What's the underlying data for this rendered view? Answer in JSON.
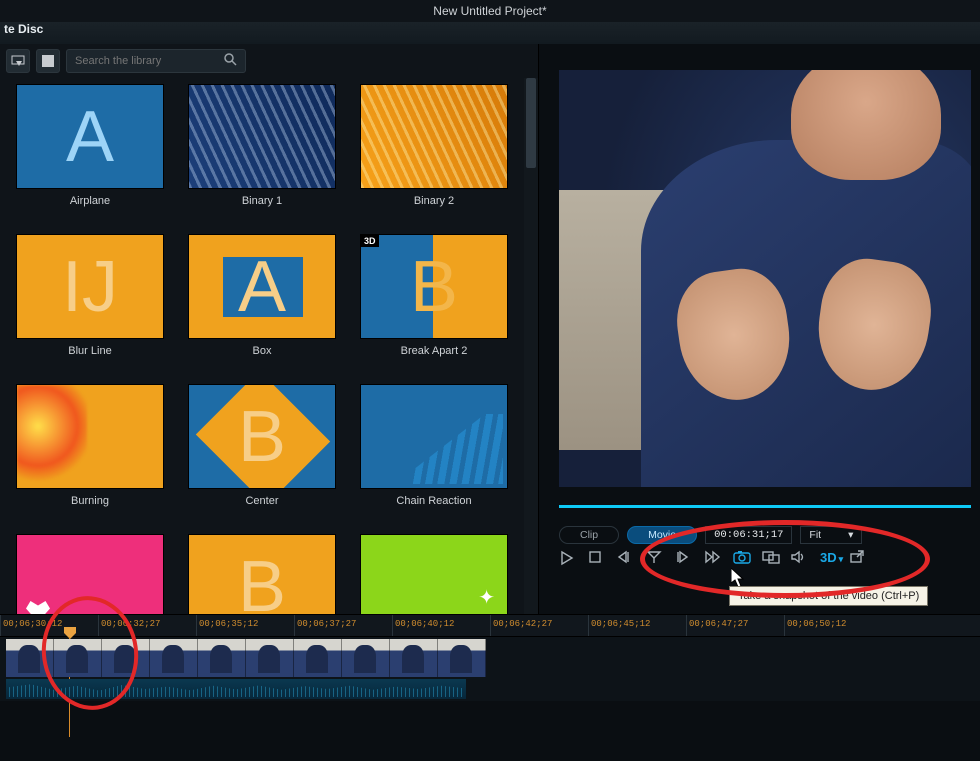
{
  "window": {
    "title": "New Untitled Project*"
  },
  "tabbar": {
    "label": "te Disc"
  },
  "library": {
    "search_placeholder": "Search the library",
    "items": [
      {
        "label": "Airplane",
        "bg": "#1e6ca6",
        "letter": "A",
        "letter_color": "#9dd4f7",
        "variant": "plain"
      },
      {
        "label": "Binary 1",
        "bg": "linear-gradient(60deg,#1c3f7a 0%,#0f2a5a 100%)",
        "letter": "",
        "variant": "binaryBlue"
      },
      {
        "label": "Binary 2",
        "bg": "linear-gradient(60deg,#f7a21a 0%,#d67a08 100%)",
        "letter": "",
        "variant": "binaryOrange"
      },
      {
        "label": "Blur Line",
        "bg": "#f0a21e",
        "letter": "IJ",
        "letter_color": "#f7ce88",
        "variant": "plain"
      },
      {
        "label": "Box",
        "bg": "#f0a21e",
        "letter": "A",
        "letter_color": "#f7ce88",
        "variant": "box"
      },
      {
        "label": "Break Apart 2",
        "bg": "#1e6ca6",
        "letter": "B",
        "letter_color": "#f3b64a",
        "variant": "split",
        "badge3d": true
      },
      {
        "label": "Burning",
        "bg": "#f0a21e",
        "letter": "",
        "variant": "fire"
      },
      {
        "label": "Center",
        "bg": "#1e6ca6",
        "letter": "B",
        "letter_color": "#f7ce88",
        "variant": "diamond"
      },
      {
        "label": "Chain Reaction",
        "bg": "#1e6ca6",
        "letter": "",
        "variant": "bars"
      },
      {
        "label": "",
        "bg": "#ee2f7b",
        "letter": "",
        "variant": "hearts"
      },
      {
        "label": "",
        "bg": "#f0a21e",
        "letter": "B",
        "letter_color": "#f7ce88",
        "variant": "plain"
      },
      {
        "label": "",
        "bg": "#8cd61a",
        "letter": "",
        "variant": "sparkle"
      }
    ]
  },
  "preview": {
    "tabs": {
      "clip": "Clip",
      "movie": "Movie"
    },
    "timecode": "00:06:31;17",
    "zoom": "Fit",
    "zoom_caret": "▾",
    "buttons": {
      "play": "play-icon",
      "stop": "stop-icon",
      "prev": "prev-frame-icon",
      "trim": "trim-icon",
      "next": "next-frame-icon",
      "ff": "fast-forward-icon",
      "snapshot": "camera-icon",
      "dual": "dual-view-icon",
      "vol": "volume-icon",
      "threeD": "3D",
      "threeD_caret": "▾",
      "undock": "undock-icon"
    },
    "tooltip": "Take a snapshot of the video (Ctrl+P)"
  },
  "timeline": {
    "ticks": [
      "00;06;30;12",
      "00;06;32;27",
      "00;06;35;12",
      "00;06;37;27",
      "00;06;40;12",
      "00;06;42;27",
      "00;06;45;12",
      "00;06;47;27",
      "00;06;50;12"
    ]
  }
}
